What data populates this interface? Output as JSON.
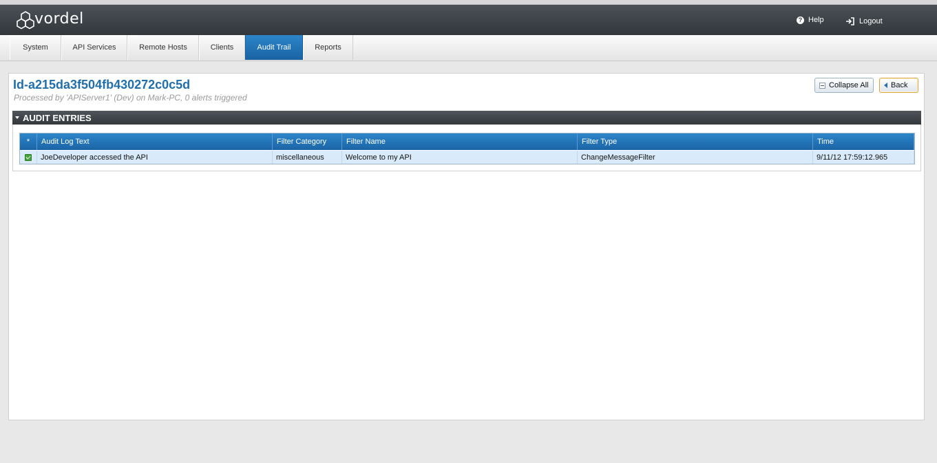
{
  "app": {
    "logo_text": "vordel"
  },
  "header": {
    "help_label": "Help",
    "logout_label": "Logout"
  },
  "tabs": [
    {
      "label": "System"
    },
    {
      "label": "API Services"
    },
    {
      "label": "Remote Hosts"
    },
    {
      "label": "Clients"
    },
    {
      "label": "Audit Trail",
      "active": true
    },
    {
      "label": "Reports"
    }
  ],
  "detail": {
    "title": "Id-a215da3f504fb430272c0c5d",
    "subtitle": "Processed by 'APIServer1' (Dev) on Mark-PC, 0 alerts triggered",
    "collapse_label": "Collapse All",
    "back_label": "Back"
  },
  "section": {
    "title": "AUDIT ENTRIES"
  },
  "table": {
    "columns": [
      "*",
      "Audit Log Text",
      "Filter Category",
      "Filter Name",
      "Filter Type",
      "Time"
    ],
    "rows": [
      {
        "status": "success",
        "text": "JoeDeveloper accessed the API",
        "category": "miscellaneous",
        "name": "Welcome to my API",
        "type": "ChangeMessageFilter",
        "time": "9/11/12 17:59:12.965"
      }
    ]
  },
  "colors": {
    "accent": "#1f6fae",
    "tab_active": "#1a63a3",
    "header": "#3a3e43",
    "success": "#46a33a"
  }
}
